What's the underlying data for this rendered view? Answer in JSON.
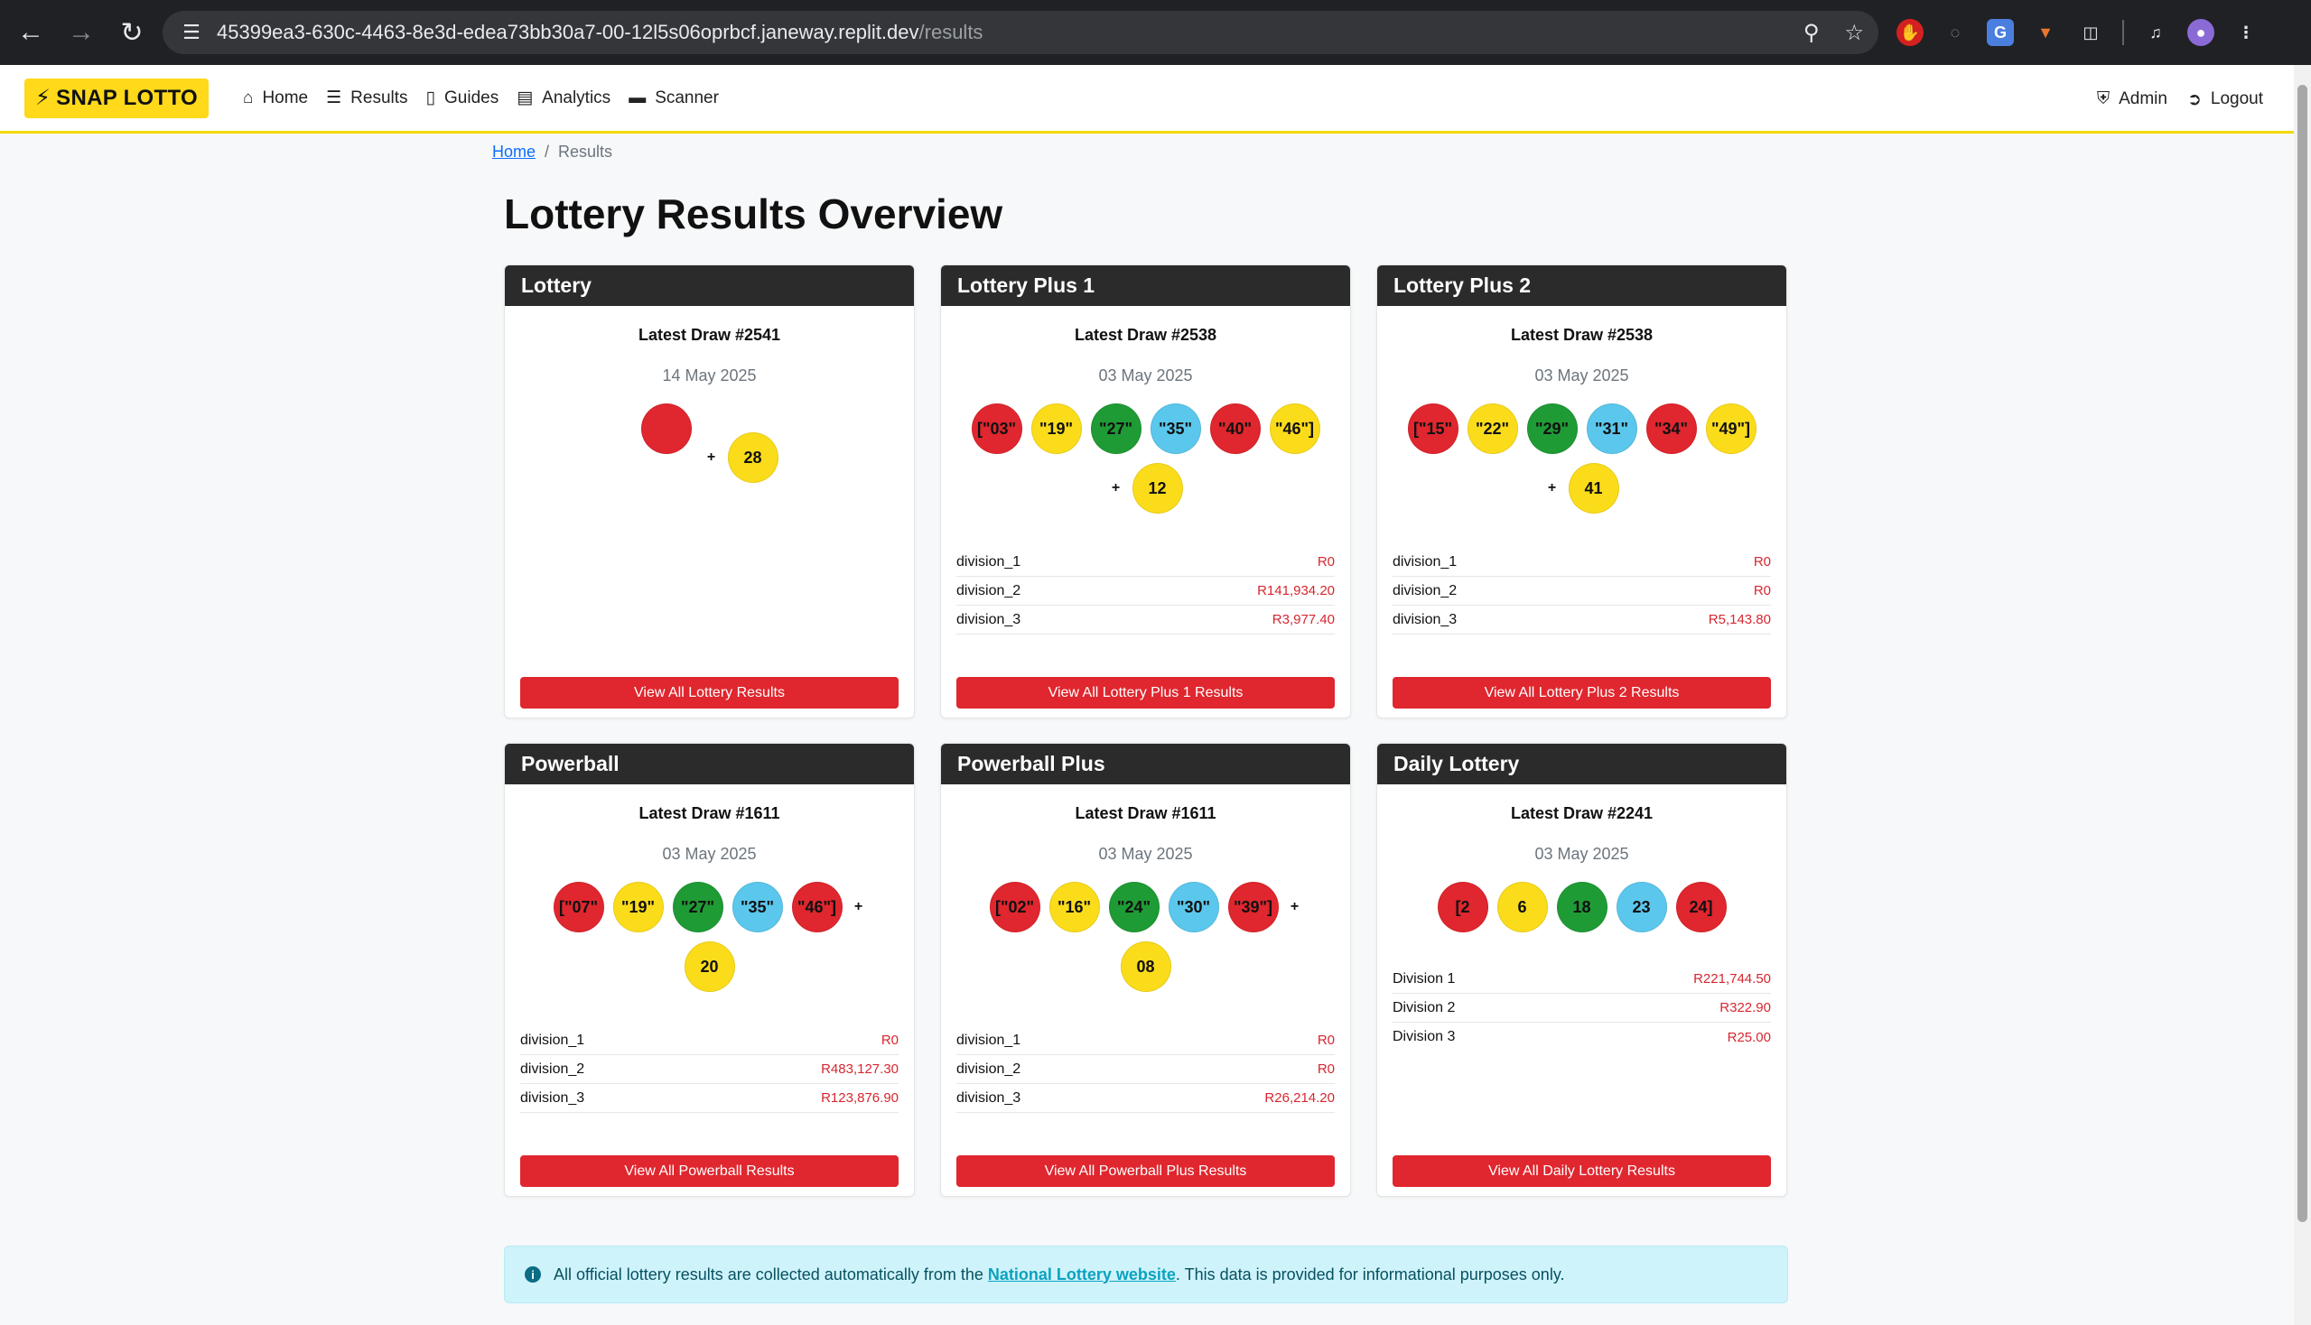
{
  "browser": {
    "url_host": "45399ea3-630c-4463-8e3d-edea73bb30a7-00-12l5s06oprbcf.janeway.replit.dev",
    "url_path": "/results"
  },
  "navbar": {
    "brand": "SNAP LOTTO",
    "links": [
      "Home",
      "Results",
      "Guides",
      "Analytics",
      "Scanner"
    ],
    "right_links": [
      "Admin",
      "Logout"
    ]
  },
  "breadcrumb": {
    "home": "Home",
    "sep": "/",
    "current": "Results"
  },
  "page_title": "Lottery Results Overview",
  "cards": [
    {
      "title": "Lottery",
      "draw": "Latest Draw #2541",
      "date": "14 May 2025",
      "balls": [
        {
          "label": "",
          "color": "red"
        }
      ],
      "bonus": "28",
      "bonus_color": "yellow",
      "divisions": [],
      "button": "View All Lottery Results"
    },
    {
      "title": "Lottery Plus 1",
      "draw": "Latest Draw #2538",
      "date": "03 May 2025",
      "balls": [
        {
          "label": "[\"03\"",
          "color": "red"
        },
        {
          "label": "\"19\"",
          "color": "yellow"
        },
        {
          "label": "\"27\"",
          "color": "green"
        },
        {
          "label": "\"35\"",
          "color": "blue"
        },
        {
          "label": "\"40\"",
          "color": "red"
        },
        {
          "label": "\"46\"]",
          "color": "yellow"
        }
      ],
      "bonus": "12",
      "bonus_color": "yellow",
      "divisions": [
        {
          "name": "division_1",
          "value": "R0"
        },
        {
          "name": "division_2",
          "value": "R141,934.20"
        },
        {
          "name": "division_3",
          "value": "R3,977.40"
        }
      ],
      "button": "View All Lottery Plus 1 Results"
    },
    {
      "title": "Lottery Plus 2",
      "draw": "Latest Draw #2538",
      "date": "03 May 2025",
      "balls": [
        {
          "label": "[\"15\"",
          "color": "red"
        },
        {
          "label": "\"22\"",
          "color": "yellow"
        },
        {
          "label": "\"29\"",
          "color": "green"
        },
        {
          "label": "\"31\"",
          "color": "blue"
        },
        {
          "label": "\"34\"",
          "color": "red"
        },
        {
          "label": "\"49\"]",
          "color": "yellow"
        }
      ],
      "bonus": "41",
      "bonus_color": "yellow",
      "divisions": [
        {
          "name": "division_1",
          "value": "R0"
        },
        {
          "name": "division_2",
          "value": "R0"
        },
        {
          "name": "division_3",
          "value": "R5,143.80"
        }
      ],
      "button": "View All Lottery Plus 2 Results"
    },
    {
      "title": "Powerball",
      "draw": "Latest Draw #1611",
      "date": "03 May 2025",
      "balls": [
        {
          "label": "[\"07\"",
          "color": "red"
        },
        {
          "label": "\"19\"",
          "color": "yellow"
        },
        {
          "label": "\"27\"",
          "color": "green"
        },
        {
          "label": "\"35\"",
          "color": "blue"
        },
        {
          "label": "\"46\"]",
          "color": "red"
        }
      ],
      "plus_inline": true,
      "bonus": "20",
      "bonus_color": "yellow",
      "divisions": [
        {
          "name": "division_1",
          "value": "R0"
        },
        {
          "name": "division_2",
          "value": "R483,127.30"
        },
        {
          "name": "division_3",
          "value": "R123,876.90"
        }
      ],
      "button": "View All Powerball Results"
    },
    {
      "title": "Powerball Plus",
      "draw": "Latest Draw #1611",
      "date": "03 May 2025",
      "balls": [
        {
          "label": "[\"02\"",
          "color": "red"
        },
        {
          "label": "\"16\"",
          "color": "yellow"
        },
        {
          "label": "\"24\"",
          "color": "green"
        },
        {
          "label": "\"30\"",
          "color": "blue"
        },
        {
          "label": "\"39\"]",
          "color": "red"
        }
      ],
      "plus_inline": true,
      "bonus": "08",
      "bonus_color": "yellow",
      "divisions": [
        {
          "name": "division_1",
          "value": "R0"
        },
        {
          "name": "division_2",
          "value": "R0"
        },
        {
          "name": "division_3",
          "value": "R26,214.20"
        }
      ],
      "button": "View All Powerball Plus Results"
    },
    {
      "title": "Daily Lottery",
      "draw": "Latest Draw #2241",
      "date": "03 May 2025",
      "balls": [
        {
          "label": "[2",
          "color": "red"
        },
        {
          "label": "6",
          "color": "yellow"
        },
        {
          "label": "18",
          "color": "green"
        },
        {
          "label": "23",
          "color": "blue"
        },
        {
          "label": "24]",
          "color": "red"
        }
      ],
      "bonus": "",
      "divisions": [
        {
          "name": "Division 1",
          "value": "R221,744.50"
        },
        {
          "name": "Division 2",
          "value": "R322.90"
        },
        {
          "name": "Division 3",
          "value": "R25.00"
        }
      ],
      "button": "View All Daily Lottery Results"
    }
  ],
  "alert": {
    "before": "All official lottery results are collected automatically from the ",
    "link": "National Lottery website",
    "after": ". This data is provided for informational purposes only."
  },
  "colors": {
    "accent": "#e0262e",
    "brand": "#ffd91a",
    "header": "#2b2b2b"
  }
}
